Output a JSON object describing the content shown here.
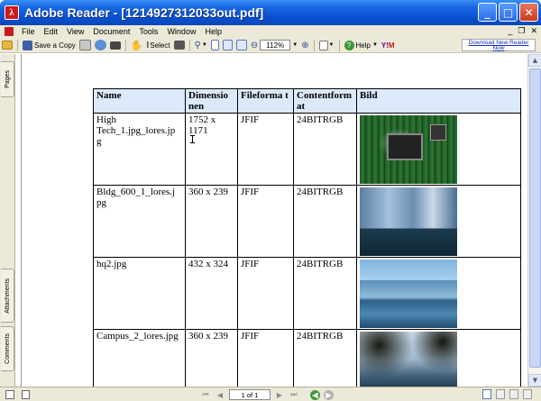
{
  "window": {
    "app_icon": "adobe-reader-icon",
    "title": "Adobe Reader - [1214927312033out.pdf]",
    "minimize": "_",
    "maximize": "□",
    "close": "✕"
  },
  "menu": {
    "items": [
      "File",
      "Edit",
      "View",
      "Document",
      "Tools",
      "Window",
      "Help"
    ],
    "mdi_minimize": "_",
    "mdi_restore": "❐",
    "mdi_close": "✕"
  },
  "toolbar": {
    "save_copy_label": "Save a Copy",
    "select_label": "Select",
    "zoom_value": "112%",
    "help_label": "Help",
    "download_line1": "Download New Reader",
    "download_line2": "Now",
    "colors": {
      "accent": "#0a4fd0",
      "yahoo": "#7b0099"
    }
  },
  "side_tabs": [
    "Pages",
    "Attachments",
    "Comments"
  ],
  "table": {
    "headers": [
      "Name",
      "Dimensio nen",
      "Fileforma t",
      "Contentform at",
      "Bild"
    ],
    "rows": [
      {
        "name": "High Tech_1.jpg_lores.jp g",
        "dimension": "1752 x 1171",
        "fileformat": "JFIF",
        "contentformat": "24BITRGB",
        "image": "circuit-board-photo"
      },
      {
        "name": "Bldg_600_1_lores.j pg",
        "dimension": "360 x 239",
        "fileformat": "JFIF",
        "contentformat": "24BITRGB",
        "image": "glass-building-photo"
      },
      {
        "name": "hq2.jpg",
        "dimension": "432 x 324",
        "fileformat": "JFIF",
        "contentformat": "24BITRGB",
        "image": "hq-towers-photo"
      },
      {
        "name": "Campus_2_lores.jpg",
        "dimension": "360 x 239",
        "fileformat": "JFIF",
        "contentformat": "24BITRGB",
        "image": "campus-photo"
      }
    ]
  },
  "status": {
    "page_indicator": "1 of 1"
  }
}
